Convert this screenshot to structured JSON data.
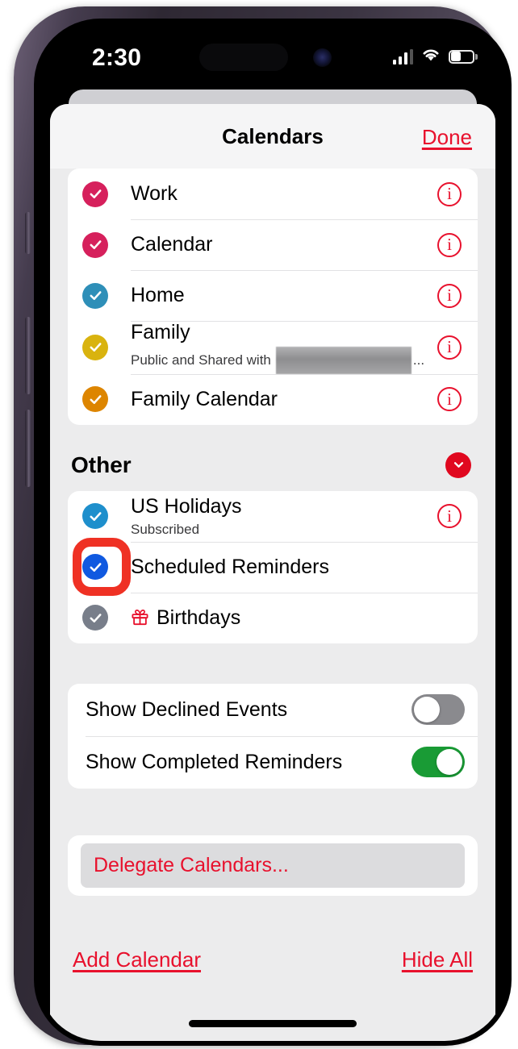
{
  "status_bar": {
    "time": "2:30",
    "cellular_icon": "cellular-signal-icon",
    "wifi_icon": "wifi-icon",
    "battery_icon": "battery-icon"
  },
  "sheet": {
    "title": "Calendars",
    "done_label": "Done"
  },
  "calendars": [
    {
      "name": "Work",
      "color": "#D6205C",
      "checked": true,
      "subtitle": "",
      "info": true
    },
    {
      "name": "Calendar",
      "color": "#D6205C",
      "checked": true,
      "subtitle": "",
      "info": true
    },
    {
      "name": "Home",
      "color": "#2E8FB8",
      "checked": true,
      "subtitle": "",
      "info": true
    },
    {
      "name": "Family",
      "color": "#D9B30F",
      "checked": true,
      "subtitle": "Public and Shared with",
      "subtitle_suffix": "...",
      "redacted": true,
      "info": true
    },
    {
      "name": "Family Calendar",
      "color": "#DD8500",
      "checked": true,
      "subtitle": "",
      "info": true
    }
  ],
  "other_section": {
    "title": "Other",
    "collapse_icon": "chevron-down-icon",
    "collapse_color": "#E0081F",
    "items": [
      {
        "name": "US Holidays",
        "color": "#1E8FCC",
        "checked": true,
        "subtitle": "Subscribed",
        "info": true,
        "icon": "",
        "highlighted": false
      },
      {
        "name": "Scheduled Reminders",
        "color": "#1059E0",
        "checked": true,
        "subtitle": "",
        "info": false,
        "icon": "",
        "highlighted": true
      },
      {
        "name": "Birthdays",
        "color": "#787E8A",
        "checked": true,
        "subtitle": "",
        "info": false,
        "icon": "gift-icon",
        "highlighted": false
      }
    ]
  },
  "settings": [
    {
      "label": "Show Declined Events",
      "on": false
    },
    {
      "label": "Show Completed Reminders",
      "on": true
    }
  ],
  "delegate": {
    "label": "Delegate Calendars..."
  },
  "footer": {
    "add_label": "Add Calendar",
    "hide_label": "Hide All"
  },
  "colors": {
    "accent_red": "#E8112D",
    "annotation_red": "#EF3124",
    "toggle_on_green": "#199B35",
    "toggle_off_gray": "#8A8A8E"
  }
}
